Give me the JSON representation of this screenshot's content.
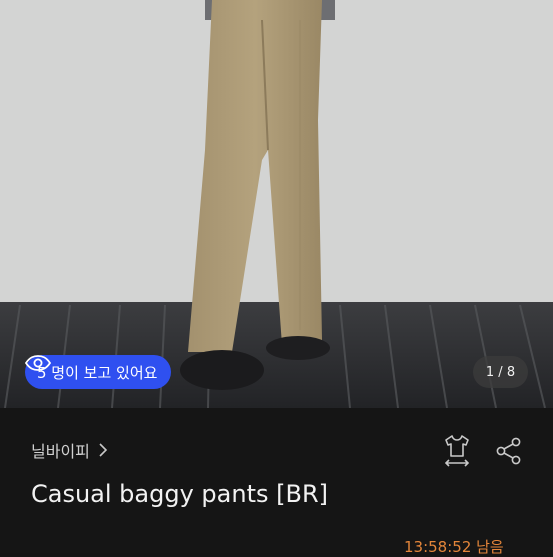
{
  "viewers": {
    "label": "5 명이 보고 있어요"
  },
  "gallery": {
    "counter": "1 / 8"
  },
  "product": {
    "shop_name": "닐바이피",
    "title": "Casual baggy pants [BR]",
    "time_left": "13:58:52 남음"
  },
  "icons": {
    "eye": "eye-icon",
    "chevron": "chevron-right-icon",
    "size": "shirt-size-icon",
    "share": "share-icon"
  },
  "colors": {
    "badge": "#2f50f0",
    "timer": "#e3853a",
    "background": "#151515"
  }
}
